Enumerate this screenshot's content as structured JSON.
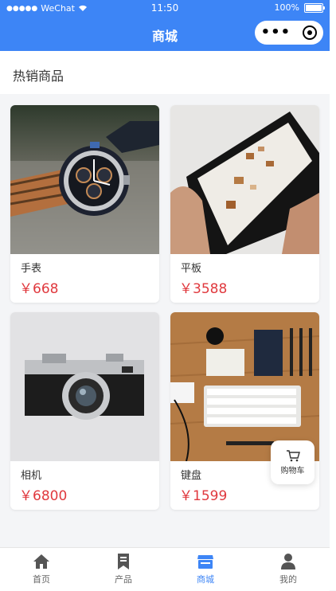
{
  "status_bar": {
    "carrier": "WeChat",
    "time": "11:50",
    "battery": "100%"
  },
  "nav": {
    "title": "商城",
    "more_icon": "more-dots-icon",
    "close_icon": "target-icon"
  },
  "section": {
    "title": "热销商品"
  },
  "products": [
    {
      "name": "手表",
      "price": "￥668"
    },
    {
      "name": "平板",
      "price": "￥3588"
    },
    {
      "name": "相机",
      "price": "￥6800"
    },
    {
      "name": "键盘",
      "price": "￥1599"
    }
  ],
  "float_cart": {
    "label": "购物车"
  },
  "tabbar": {
    "tabs": [
      {
        "label": "首页",
        "icon": "home-icon"
      },
      {
        "label": "产品",
        "icon": "bookmark-icon"
      },
      {
        "label": "商城",
        "icon": "store-icon",
        "active": true
      },
      {
        "label": "我的",
        "icon": "user-icon"
      }
    ]
  },
  "colors": {
    "primary": "#3d85f6",
    "price": "#e0393e"
  }
}
